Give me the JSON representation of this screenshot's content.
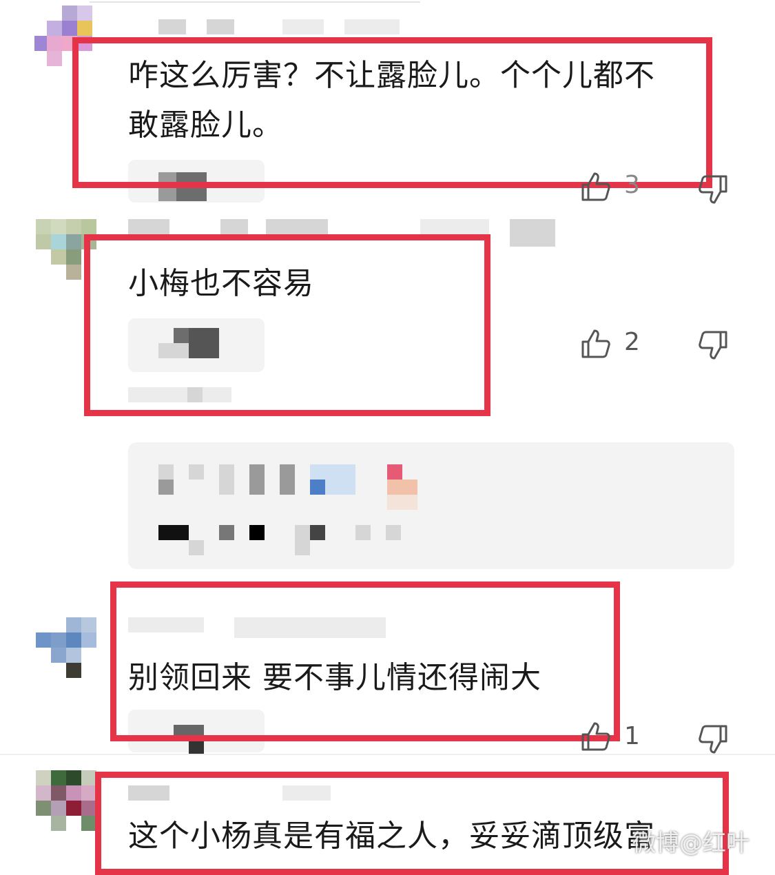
{
  "comments": [
    {
      "text_line1": "咋这么厉害？不让露脸儿。个个儿都不",
      "text_line2": "敢露脸儿。",
      "likes": "3"
    },
    {
      "text": "小梅也不容易",
      "likes": "2"
    },
    {
      "text": "别领回来 要不事儿情还得闹大",
      "likes": "1"
    },
    {
      "text": "这个小杨真是有福之人，妥妥滴顶级富"
    }
  ],
  "watermark": "微博@红叶",
  "icons": {
    "like": "thumbs-up-icon",
    "dislike": "thumbs-down-icon"
  },
  "colors": {
    "highlight": "#e53348"
  }
}
